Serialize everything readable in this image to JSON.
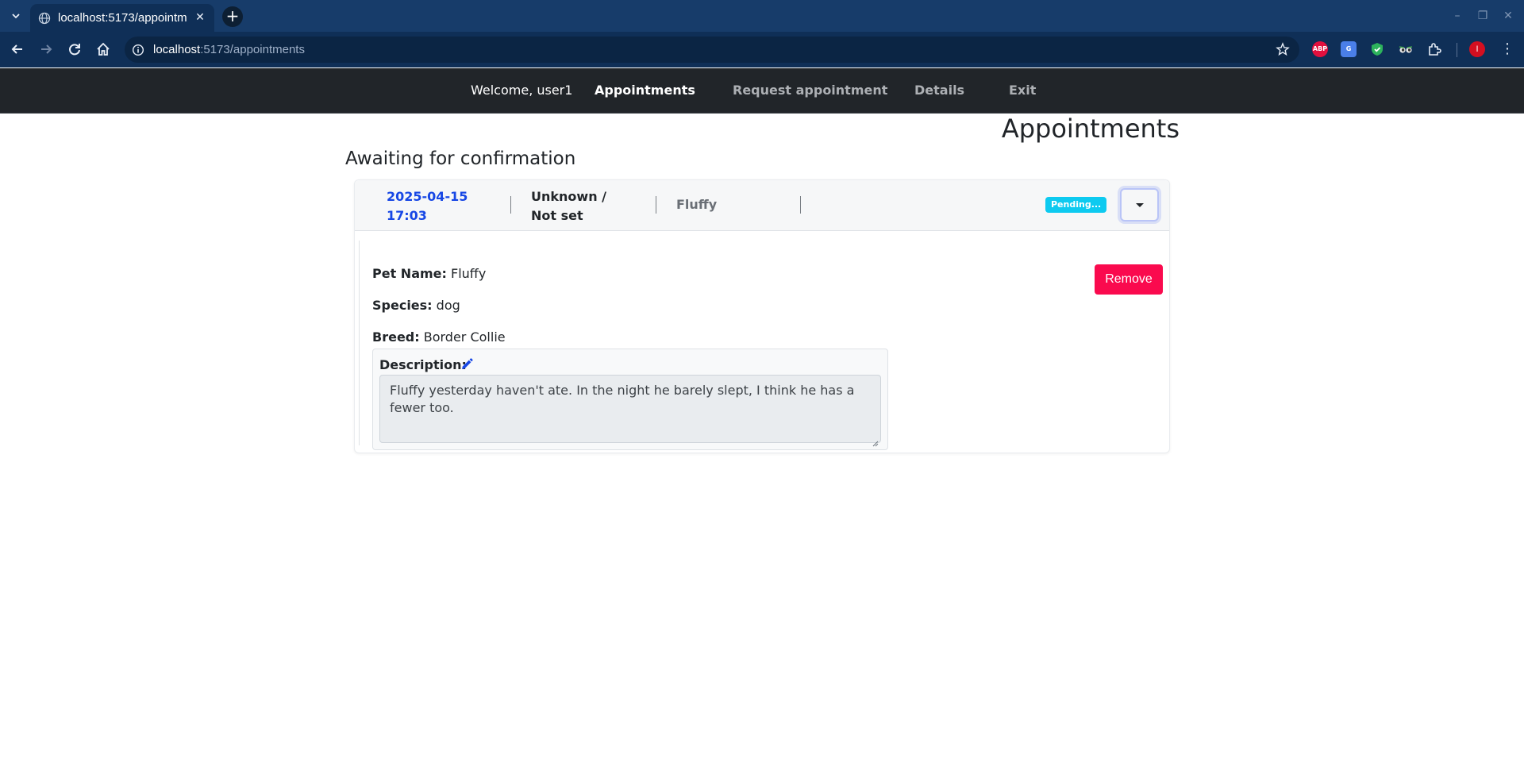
{
  "browser": {
    "tab_title": "localhost:5173/appointm",
    "url_host": "localhost",
    "url_path": ":5173/appointments",
    "extensions": [
      {
        "name": "abp-icon",
        "label": "ABP",
        "color": "#e2103e"
      },
      {
        "name": "translate-icon",
        "label": "G",
        "color": "#4a7fe8"
      },
      {
        "name": "shield-icon",
        "label": "",
        "color": "#2db35c"
      },
      {
        "name": "eyes-icon",
        "label": "",
        "color": "#888888"
      }
    ],
    "profile_initial": "I"
  },
  "navbar": {
    "welcome": "Welcome, user1",
    "links": [
      "Appointments",
      "Request appointment",
      "Details",
      "Exit"
    ],
    "active": "Appointments"
  },
  "page": {
    "title": "Appointments",
    "section_title": "Awaiting for confirmation"
  },
  "appointment": {
    "date": "2025-04-15",
    "time": "17:03",
    "doctor_line1": "Unknown /",
    "doctor_line2": "Not set",
    "pet": "Fluffy",
    "status": "Pending...",
    "pet_name_label": "Pet Name:",
    "pet_name": "Fluffy",
    "species_label": "Species:",
    "species": "dog",
    "breed_label": "Breed:",
    "breed": "Border Collie",
    "remove_label": "Remove",
    "description_label": "Description:",
    "description": "Fluffy yesterday haven't ate. In the night he barely slept, I think he has a fewer too."
  }
}
